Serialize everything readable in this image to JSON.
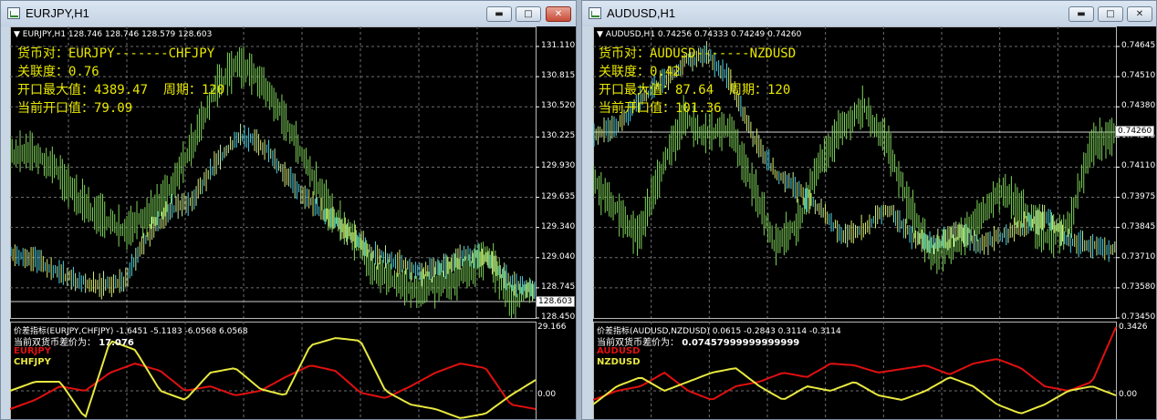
{
  "left": {
    "title": "EURJPY,H1",
    "symbol_line": "▼ EURJPY,H1  128.746 128.746 128.579 128.603",
    "info": [
      "货币对：EURJPY-------CHFJPY",
      "关联度：0.76",
      "开口最大值：4389.47  周期：120",
      "当前开口值：79.09"
    ],
    "price_ticks": [
      "131.110",
      "130.815",
      "130.520",
      "130.225",
      "129.930",
      "129.635",
      "129.340",
      "129.040",
      "128.745",
      "128.450"
    ],
    "current_price": "128.603",
    "indicator_name": "价差指标(EURJPY,CHFJPY) -1.6451 -5.1183 -6.0568 6.0568",
    "diff_label": "当前双货币差价为：",
    "diff_value": "17.076",
    "legend": [
      "EURJPY",
      "CHFJPY"
    ],
    "ind_ticks": [
      "29.166",
      "0.00"
    ]
  },
  "right": {
    "title": "AUDUSD,H1",
    "symbol_line": "▼ AUDUSD,H1  0.74256 0.74333 0.74249 0.74260",
    "info": [
      "货币对：AUDUSD-------NZDUSD",
      "关联度：0.42",
      "开口最大值：87.64  周期：120",
      "当前开口值：101.36"
    ],
    "price_ticks": [
      "0.74645",
      "0.74510",
      "0.74380",
      "0.74245",
      "0.74110",
      "0.73975",
      "0.73845",
      "0.73710",
      "0.73580",
      "0.73450"
    ],
    "current_price": "0.74260",
    "indicator_name": "价差指标(AUDUSD,NZDUSD) 0.0615 -0.2843 0.3114 -0.3114",
    "diff_label": "当前双货币差价为：",
    "diff_value": "0.07457999999999999",
    "legend": [
      "AUDUSD",
      "NZDUSD"
    ],
    "ind_ticks": [
      "0.3426",
      "0.00"
    ]
  },
  "controls": {
    "minimize": "▬",
    "maximize": "□",
    "close": "✕"
  },
  "colors": {
    "background": "#000000",
    "grid": "#6e6e6e",
    "bars_main": "#7fd35a",
    "bars_alt": "#d9e96a",
    "bars_accent": "#4ed0e0",
    "line_red": "#e01010",
    "line_yellow": "#e8e840"
  }
}
